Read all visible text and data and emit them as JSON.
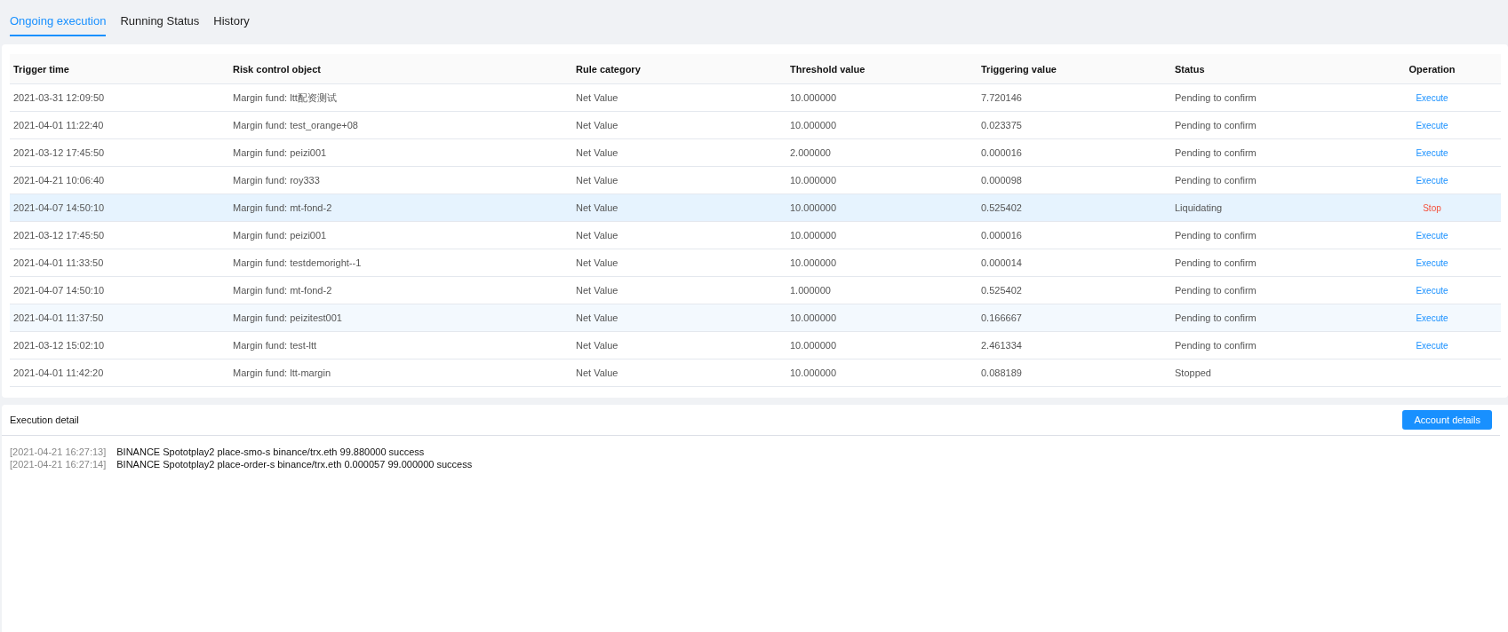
{
  "tabs": [
    {
      "label": "Ongoing execution",
      "selected": true
    },
    {
      "label": "Running Status",
      "selected": false
    },
    {
      "label": "History",
      "selected": false
    }
  ],
  "table": {
    "columns": [
      "Trigger time",
      "Risk control object",
      "Rule category",
      "Threshold value",
      "Triggering value",
      "Status",
      "Operation"
    ],
    "rows": [
      {
        "time": "2021-03-31 12:09:50",
        "object": "Margin fund: ltt配资测试",
        "category": "Net Value",
        "threshold": "10.000000",
        "triggering": "7.720146",
        "status": "Pending to confirm",
        "operation": {
          "kind": "execute",
          "label": "Execute"
        },
        "selected": false,
        "hovered": false
      },
      {
        "time": "2021-04-01 11:22:40",
        "object": "Margin fund: test_orange+08",
        "category": "Net Value",
        "threshold": "10.000000",
        "triggering": "0.023375",
        "status": "Pending to confirm",
        "operation": {
          "kind": "execute",
          "label": "Execute"
        },
        "selected": false,
        "hovered": false
      },
      {
        "time": "2021-03-12 17:45:50",
        "object": "Margin fund: peizi001",
        "category": "Net Value",
        "threshold": "2.000000",
        "triggering": "0.000016",
        "status": "Pending to confirm",
        "operation": {
          "kind": "execute",
          "label": "Execute"
        },
        "selected": false,
        "hovered": false
      },
      {
        "time": "2021-04-21 10:06:40",
        "object": "Margin fund: roy333",
        "category": "Net Value",
        "threshold": "10.000000",
        "triggering": "0.000098",
        "status": "Pending to confirm",
        "operation": {
          "kind": "execute",
          "label": "Execute"
        },
        "selected": false,
        "hovered": false
      },
      {
        "time": "2021-04-07 14:50:10",
        "object": "Margin fund: mt-fond-2",
        "category": "Net Value",
        "threshold": "10.000000",
        "triggering": "0.525402",
        "status": "Liquidating",
        "operation": {
          "kind": "stop",
          "label": "Stop"
        },
        "selected": true,
        "hovered": false
      },
      {
        "time": "2021-03-12 17:45:50",
        "object": "Margin fund: peizi001",
        "category": "Net Value",
        "threshold": "10.000000",
        "triggering": "0.000016",
        "status": "Pending to confirm",
        "operation": {
          "kind": "execute",
          "label": "Execute"
        },
        "selected": false,
        "hovered": false
      },
      {
        "time": "2021-04-01 11:33:50",
        "object": "Margin fund: testdemoright--1",
        "category": "Net Value",
        "threshold": "10.000000",
        "triggering": "0.000014",
        "status": "Pending to confirm",
        "operation": {
          "kind": "execute",
          "label": "Execute"
        },
        "selected": false,
        "hovered": false
      },
      {
        "time": "2021-04-07 14:50:10",
        "object": "Margin fund: mt-fond-2",
        "category": "Net Value",
        "threshold": "1.000000",
        "triggering": "0.525402",
        "status": "Pending to confirm",
        "operation": {
          "kind": "execute",
          "label": "Execute"
        },
        "selected": false,
        "hovered": false
      },
      {
        "time": "2021-04-01 11:37:50",
        "object": "Margin fund: peizitest001",
        "category": "Net Value",
        "threshold": "10.000000",
        "triggering": "0.166667",
        "status": "Pending to confirm",
        "operation": {
          "kind": "execute",
          "label": "Execute"
        },
        "selected": false,
        "hovered": true
      },
      {
        "time": "2021-03-12 15:02:10",
        "object": "Margin fund: test-ltt",
        "category": "Net Value",
        "threshold": "10.000000",
        "triggering": "2.461334",
        "status": "Pending to confirm",
        "operation": {
          "kind": "execute",
          "label": "Execute"
        },
        "selected": false,
        "hovered": false
      },
      {
        "time": "2021-04-01 11:42:20",
        "object": "Margin fund: ltt-margin",
        "category": "Net Value",
        "threshold": "10.000000",
        "triggering": "0.088189",
        "status": "Stopped",
        "selected": false,
        "hovered": false
      }
    ]
  },
  "execution_detail": {
    "title": "Execution detail",
    "button": "Account details",
    "log": [
      {
        "time": "[2021-04-21 16:27:13]",
        "message": "BINANCE Spototplay2 place-smo-s binance/trx.eth 99.880000 success"
      },
      {
        "time": "[2021-04-21 16:27:14]",
        "message": "BINANCE Spototplay2 place-order-s binance/trx.eth 0.000057 99.000000 success"
      }
    ]
  }
}
